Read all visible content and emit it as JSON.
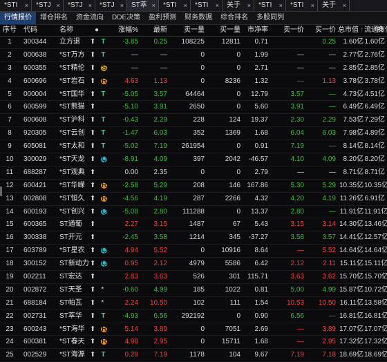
{
  "tabs": [
    "*STI",
    "*STJ",
    "*STJ",
    "*STJ",
    "ST萃",
    "*STI",
    "*STI",
    "关于",
    "*STI",
    "*STI",
    "关于"
  ],
  "subtabs": [
    "行情报价",
    "增仓排名",
    "资金流向",
    "DDE决策",
    "盈利预测",
    "财务数据",
    "综合排名",
    "多股同列"
  ],
  "columns": [
    "序号",
    "代码",
    "名称",
    "",
    "涨幅%",
    "最新",
    "卖一量",
    "买一量",
    "市净率",
    "卖一价",
    "买一价",
    "总市值",
    "流通市值",
    "换"
  ],
  "sort_indicator": "↑",
  "rows": [
    {
      "n": "1",
      "code": "300344",
      "name": "立方退",
      "arrow": "⬆",
      "tag": "T",
      "chg": "-3.85",
      "last": "0.25",
      "sellq": "108225",
      "buyq": "12811",
      "pb": "0.71",
      "sellp": "",
      "buyp": "0.25",
      "mcap": "1.60亿",
      "fcap": "1.60亿",
      "color": "green"
    },
    {
      "n": "2",
      "code": "000638",
      "name": "*ST万方",
      "arrow": "⬆",
      "tag": "T",
      "chg": "—",
      "last": "—",
      "sellq": "0",
      "buyq": "0",
      "pb": "1.99",
      "sellp": "—",
      "buyp": "—",
      "mcap": "2.77亿",
      "fcap": "2.76亿",
      "color": "white"
    },
    {
      "n": "3",
      "code": "600355",
      "name": "*ST精伦",
      "arrow": "⬆",
      "tag": "S",
      "chg": "—",
      "last": "—",
      "sellq": "0",
      "buyq": "0",
      "pb": "2.71",
      "sellp": "—",
      "buyp": "—",
      "mcap": "2.85亿",
      "fcap": "2.85亿",
      "color": "white"
    },
    {
      "n": "4",
      "code": "600696",
      "name": "*ST岩石",
      "arrow": "⬆",
      "tag": "R",
      "chg": "4.63",
      "last": "1.13",
      "sellq": "0",
      "buyq": "8236",
      "pb": "1.32",
      "sellp": "—",
      "buyp": "1.13",
      "mcap": "3.78亿",
      "fcap": "3.78亿",
      "color": "red"
    },
    {
      "n": "5",
      "code": "000004",
      "name": "*ST国华",
      "arrow": "⬆",
      "tag": "T",
      "chg": "-5.05",
      "last": "3.57",
      "sellq": "64464",
      "buyq": "0",
      "pb": "12.79",
      "sellp": "3.57",
      "buyp": "—",
      "mcap": "4.73亿",
      "fcap": "4.51亿",
      "color": "green"
    },
    {
      "n": "6",
      "code": "600599",
      "name": "*ST熊猫",
      "arrow": "⬆",
      "tag": "",
      "chg": "-5.10",
      "last": "3.91",
      "sellq": "2650",
      "buyq": "0",
      "pb": "5.60",
      "sellp": "3.91",
      "buyp": "—",
      "mcap": "6.49亿",
      "fcap": "6.49亿",
      "color": "green"
    },
    {
      "n": "7",
      "code": "600608",
      "name": "*ST沪科",
      "arrow": "⬆",
      "tag": "T",
      "chg": "-0.43",
      "last": "2.29",
      "sellq": "228",
      "buyq": "124",
      "pb": "19.37",
      "sellp": "2.30",
      "buyp": "2.29",
      "mcap": "7.53亿",
      "fcap": "7.29亿",
      "color": "green"
    },
    {
      "n": "8",
      "code": "920305",
      "name": "*ST云创",
      "arrow": "⬆",
      "tag": "T",
      "chg": "-1.47",
      "last": "6.03",
      "sellq": "352",
      "buyq": "1369",
      "pb": "1.68",
      "sellp": "6.04",
      "buyp": "6.03",
      "mcap": "7.98亿",
      "fcap": "4.89亿",
      "color": "green"
    },
    {
      "n": "9",
      "code": "605081",
      "name": "*ST太和",
      "arrow": "⬆",
      "tag": "T",
      "chg": "-5.02",
      "last": "7.19",
      "sellq": "261954",
      "buyq": "0",
      "pb": "0.91",
      "sellp": "7.19",
      "buyp": "—",
      "mcap": "8.14亿",
      "fcap": "8.14亿",
      "color": "green"
    },
    {
      "n": "10",
      "code": "300029",
      "name": "*ST天龙",
      "arrow": "⬆",
      "tag": "Q",
      "chg": "-8.91",
      "last": "4.09",
      "sellq": "397",
      "buyq": "2042",
      "pb": "-46.57",
      "sellp": "4.10",
      "buyp": "4.09",
      "mcap": "8.20亿",
      "fcap": "8.20亿",
      "color": "green"
    },
    {
      "n": "11",
      "code": "688287",
      "name": "*ST观典",
      "arrow": "⬆",
      "tag": "",
      "chg": "0.00",
      "last": "2.35",
      "sellq": "0",
      "buyq": "0",
      "pb": "2.79",
      "sellp": "—",
      "buyp": "—",
      "mcap": "8.71亿",
      "fcap": "8.71亿",
      "color": "white"
    },
    {
      "n": "12",
      "code": "600421",
      "name": "*ST华嵘",
      "arrow": "⬆",
      "tag": "R",
      "chg": "-2.58",
      "last": "5.29",
      "sellq": "208",
      "buyq": "146",
      "pb": "167.86",
      "sellp": "5.30",
      "buyp": "5.29",
      "mcap": "10.35亿",
      "fcap": "10.35亿",
      "color": "green"
    },
    {
      "n": "13",
      "code": "002808",
      "name": "*ST恒久",
      "arrow": "⬆",
      "tag": "R",
      "chg": "-4.56",
      "last": "4.19",
      "sellq": "287",
      "buyq": "2266",
      "pb": "4.32",
      "sellp": "4.20",
      "buyp": "4.19",
      "mcap": "11.26亿",
      "fcap": "6.91亿",
      "color": "green"
    },
    {
      "n": "14",
      "code": "600193",
      "name": "*ST创兴",
      "arrow": "⬆",
      "tag": "Q",
      "chg": "-5.08",
      "last": "2.80",
      "sellq": "111288",
      "buyq": "0",
      "pb": "13.37",
      "sellp": "2.80",
      "buyp": "—",
      "mcap": "11.91亿",
      "fcap": "11.91亿",
      "color": "green"
    },
    {
      "n": "15",
      "code": "600365",
      "name": "ST通葡",
      "arrow": "⬆",
      "tag": "",
      "chg": "2.27",
      "last": "3.15",
      "sellq": "1487",
      "buyq": "67",
      "pb": "5.43",
      "sellp": "3.15",
      "buyp": "3.14",
      "mcap": "14.30亿",
      "fcap": "13.46亿",
      "color": "red"
    },
    {
      "n": "16",
      "code": "300338",
      "name": "ST开元",
      "arrow": "⬆",
      "tag": "",
      "chg": "-2.45",
      "last": "3.58",
      "sellq": "1214",
      "buyq": "345",
      "pb": "-37.27",
      "sellp": "3.58",
      "buyp": "3.57",
      "mcap": "14.41亿",
      "fcap": "12.57亿",
      "color": "green"
    },
    {
      "n": "17",
      "code": "603789",
      "name": "*ST星农",
      "arrow": "⬆",
      "tag": "Q",
      "chg": "4.94",
      "last": "5.52",
      "sellq": "0",
      "buyq": "10916",
      "pb": "8.64",
      "sellp": "—",
      "buyp": "5.52",
      "mcap": "14.64亿",
      "fcap": "14.64亿",
      "color": "red"
    },
    {
      "n": "18",
      "code": "300152",
      "name": "ST新动力",
      "arrow": "⬆",
      "tag": "Q",
      "chg": "0.95",
      "last": "2.12",
      "sellq": "4979",
      "buyq": "5586",
      "pb": "6.42",
      "sellp": "2.12",
      "buyp": "2.11",
      "mcap": "15.11亿",
      "fcap": "15.11亿",
      "color": "red"
    },
    {
      "n": "19",
      "code": "002211",
      "name": "ST宏达",
      "arrow": "⬆",
      "tag": "",
      "chg": "2.83",
      "last": "3.63",
      "sellq": "526",
      "buyq": "301",
      "pb": "115.71",
      "sellp": "3.63",
      "buyp": "3.62",
      "mcap": "15.70亿",
      "fcap": "15.70亿",
      "color": "red"
    },
    {
      "n": "20",
      "code": "002872",
      "name": "ST天圣",
      "arrow": "⬆",
      "tag": "*",
      "chg": "-0.60",
      "last": "4.99",
      "sellq": "185",
      "buyq": "1022",
      "pb": "0.81",
      "sellp": "5.00",
      "buyp": "4.99",
      "mcap": "15.87亿",
      "fcap": "10.72亿",
      "color": "green"
    },
    {
      "n": "21",
      "code": "688184",
      "name": "ST帕瓦",
      "arrow": "⬆",
      "tag": "*",
      "chg": "2.24",
      "last": "10.50",
      "sellq": "102",
      "buyq": "111",
      "pb": "1.54",
      "sellp": "10.53",
      "buyp": "10.50",
      "mcap": "16.11亿",
      "fcap": "13.58亿",
      "color": "red"
    },
    {
      "n": "22",
      "code": "002731",
      "name": "ST萃华",
      "arrow": "⬆",
      "tag": "T",
      "chg": "-4.93",
      "last": "6.56",
      "sellq": "292192",
      "buyq": "0",
      "pb": "0.90",
      "sellp": "6.56",
      "buyp": "—",
      "mcap": "16.81亿",
      "fcap": "16.81亿",
      "color": "green"
    },
    {
      "n": "23",
      "code": "600243",
      "name": "*ST海华",
      "arrow": "⬆",
      "tag": "R",
      "chg": "5.14",
      "last": "3.89",
      "sellq": "0",
      "buyq": "7051",
      "pb": "2.69",
      "sellp": "—",
      "buyp": "3.89",
      "mcap": "17.07亿",
      "fcap": "17.07亿",
      "color": "red"
    },
    {
      "n": "24",
      "code": "600381",
      "name": "*ST春天",
      "arrow": "⬆",
      "tag": "R",
      "chg": "4.98",
      "last": "2.95",
      "sellq": "0",
      "buyq": "15711",
      "pb": "1.68",
      "sellp": "—",
      "buyp": "2.95",
      "mcap": "17.32亿",
      "fcap": "17.32亿",
      "color": "red"
    },
    {
      "n": "25",
      "code": "002529",
      "name": "*ST海源",
      "arrow": "⬆",
      "tag": "T",
      "chg": "0.29",
      "last": "7.19",
      "sellq": "1178",
      "buyq": "104",
      "pb": "9.67",
      "sellp": "7.19",
      "buyp": "7.18",
      "mcap": "18.69亿",
      "fcap": "18.69亿",
      "color": "red"
    }
  ]
}
